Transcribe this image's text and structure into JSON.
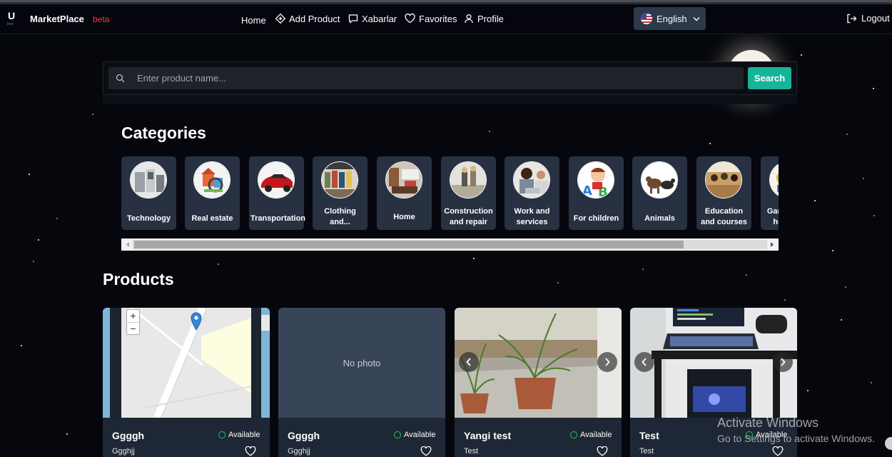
{
  "header": {
    "logo_letter": "U",
    "logo_sub": "box",
    "brand": "MarketPlace",
    "beta": "beta",
    "nav": {
      "home": "Home",
      "add_product": "Add Product",
      "xabarlar": "Xabarlar",
      "favorites": "Favorites",
      "profile": "Profile"
    },
    "language": "English",
    "logout": "Logout"
  },
  "search": {
    "placeholder": "Enter product name...",
    "button": "Search"
  },
  "categories": {
    "title": "Categories",
    "items": [
      {
        "label": "Technology"
      },
      {
        "label": "Real estate"
      },
      {
        "label": "Transportation"
      },
      {
        "label": "Clothing and..."
      },
      {
        "label": "Home"
      },
      {
        "label": "Construction and repair"
      },
      {
        "label": "Work and services"
      },
      {
        "label": "For children"
      },
      {
        "label": "Animals"
      },
      {
        "label": "Education and courses"
      },
      {
        "label": "Games and hobbies"
      }
    ]
  },
  "products": {
    "title": "Products",
    "no_photo": "No photo",
    "items": [
      {
        "name": "Ggggh",
        "status": "Available",
        "desc": "Ggghjj"
      },
      {
        "name": "Ggggh",
        "status": "Available",
        "desc": "Ggghjj"
      },
      {
        "name": "Yangi test",
        "status": "Available",
        "desc": "Test"
      },
      {
        "name": "Test",
        "status": "Available",
        "desc": "Test"
      }
    ]
  },
  "map": {
    "zoom_in": "+",
    "zoom_out": "−"
  },
  "windows_notice": {
    "title": "Activate Windows",
    "subtitle": "Go to Settings to activate Windows."
  },
  "colors": {
    "background": "#05070d",
    "accent": "#17b39a",
    "beta": "#ef3b3b",
    "card": "#273142",
    "available": "#23c45e"
  }
}
